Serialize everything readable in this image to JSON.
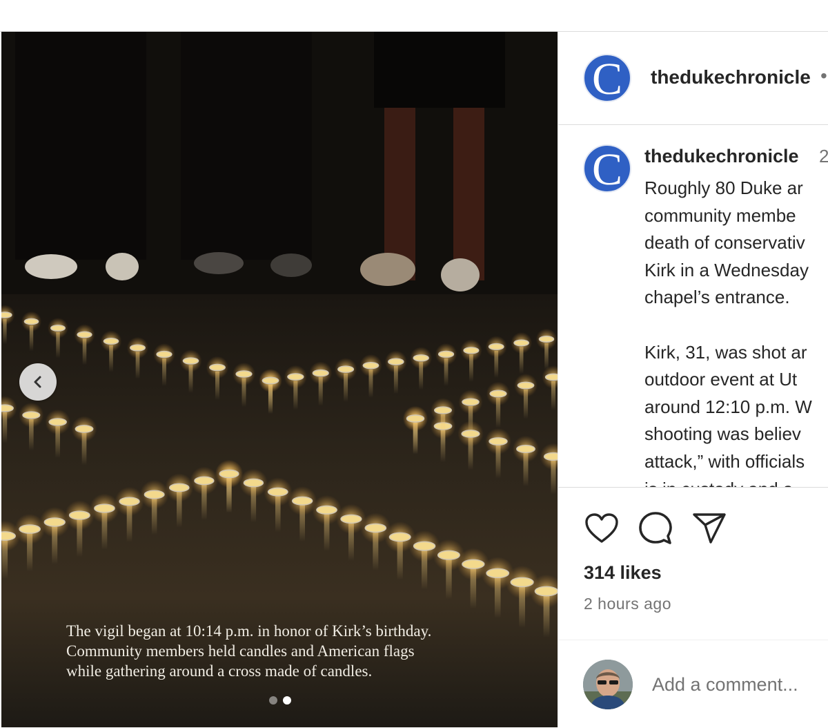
{
  "post": {
    "image": {
      "overlay_caption_lines": [
        "The vigil began at 10:14 p.m. in honor of Kirk’s birthday.",
        "Community members held candles and American flags",
        "while gathering around a cross made of candles."
      ],
      "carousel": {
        "total": 2,
        "active_index": 1
      },
      "prev_icon": "chevron-left-icon"
    },
    "header": {
      "username": "thedukechronicle",
      "separator": "•",
      "avatar_letter": "C",
      "avatar_color": "#2f60c4"
    },
    "caption": {
      "username": "thedukechronicle",
      "time_fragment": "2",
      "avatar_letter": "C",
      "lines": [
        "Roughly 80 Duke ar",
        "community membe",
        "death of conservativ",
        "Kirk in a Wednesday",
        "chapel’s entrance.",
        "",
        "Kirk, 31, was shot ar",
        "outdoor event at Ut",
        "around 12:10 p.m. W",
        "shooting was believ",
        "attack,” with officials",
        "is in custody and a"
      ]
    },
    "actions": {
      "like_icon": "heart-icon",
      "comment_icon": "comment-icon",
      "share_icon": "paper-plane-icon"
    },
    "likes_text": "314 likes",
    "time_ago": "2 hours ago",
    "add_comment": {
      "placeholder": "Add a comment..."
    }
  }
}
